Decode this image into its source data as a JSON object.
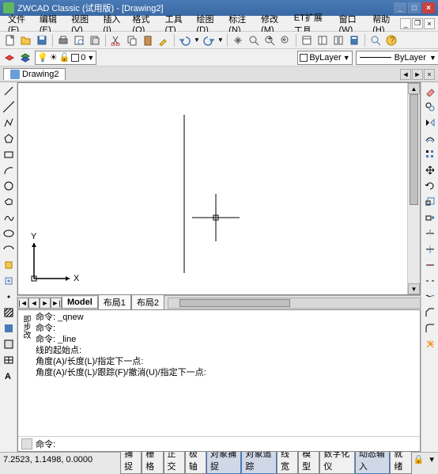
{
  "app": {
    "title": "ZWCAD Classic (试用版) - [Drawing2]"
  },
  "menus": [
    "文件(F)",
    "编辑(E)",
    "视图(V)",
    "插入(I)",
    "格式(O)",
    "工具(T)",
    "绘图(D)",
    "标注(N)",
    "修改(M)",
    "ET扩展工具",
    "窗口(W)",
    "帮助(H)"
  ],
  "layer": {
    "name": "0",
    "bylayer_color": "ByLayer",
    "bylayer_line": "ByLayer"
  },
  "drawing_tab": "Drawing2",
  "model_tabs": {
    "active": "Model",
    "layouts": [
      "布局1",
      "布局2"
    ]
  },
  "command": {
    "lines": [
      "命令: _qnew",
      "命令:",
      "命令: _line",
      "线的起始点:",
      "角度(A)/长度(L)/指定下一点:",
      "角度(A)/长度(L)/跟踪(F)/撤消(U)/指定下一点:"
    ],
    "side": "即步改",
    "prompt": "命令:"
  },
  "status": {
    "coords": "7.2523, 1.1498, 0.0000",
    "modes": [
      "捕捉",
      "栅格",
      "正交",
      "极轴",
      "对象捕捉",
      "对象追踪",
      "线宽",
      "模型",
      "数字化仪",
      "动态输入",
      "就绪"
    ],
    "active_modes": [
      "对象捕捉",
      "对象追踪",
      "动态输入"
    ]
  },
  "ucs": {
    "x": "X",
    "y": "Y"
  }
}
